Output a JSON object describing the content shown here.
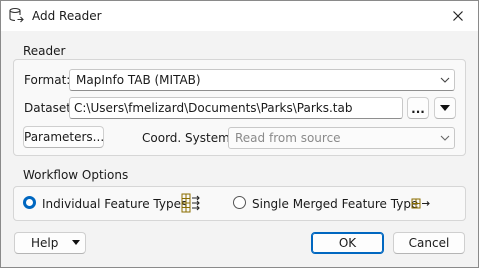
{
  "window": {
    "title": "Add Reader"
  },
  "reader_group": {
    "title": "Reader",
    "format": {
      "label": "Format:",
      "value": "MapInfo TAB (MITAB)"
    },
    "dataset": {
      "label": "Dataset:",
      "value": "C:\\Users\\fmelizard\\Documents\\Parks\\Parks.tab",
      "browse_label": "..."
    },
    "parameters_label": "Parameters...",
    "coord_system": {
      "label": "Coord. System:",
      "placeholder": "Read from source"
    }
  },
  "workflow_group": {
    "title": "Workflow Options",
    "options": [
      {
        "label": "Individual Feature Types",
        "selected": true
      },
      {
        "label": "Single Merged Feature Type",
        "selected": false
      }
    ]
  },
  "footer": {
    "help_label": "Help",
    "ok_label": "OK",
    "cancel_label": "Cancel"
  },
  "colors": {
    "accent": "#0067c0",
    "dialog_bg": "#f3f3f3"
  }
}
